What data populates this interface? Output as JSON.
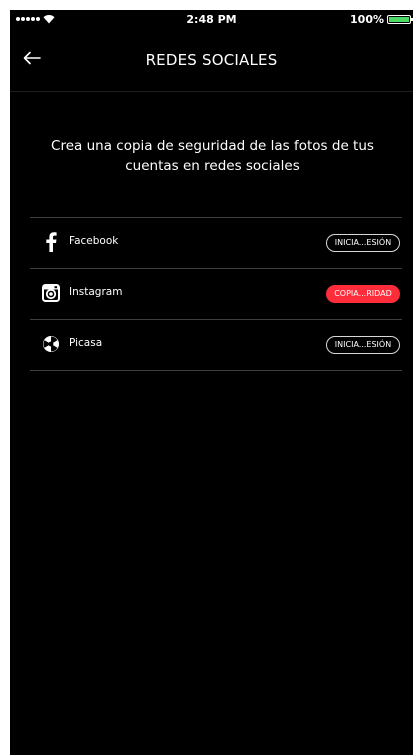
{
  "status_bar": {
    "time": "2:48 PM",
    "battery": "100%",
    "battery_level": 1.0,
    "battery_color": "#4cd964"
  },
  "nav": {
    "title": "REDES SOCIALES",
    "back_icon": "arrow-left-icon"
  },
  "intro_text": "Crea una copia de seguridad de las fotos de tus cuentas en redes sociales",
  "accounts": [
    {
      "icon": "facebook-icon",
      "label": "Facebook",
      "action": "INICIA...ESIÓN",
      "style": "outline"
    },
    {
      "icon": "instagram-icon",
      "label": "Instagram",
      "action": "COPIA...RIDAD",
      "style": "filled"
    },
    {
      "icon": "picasa-icon",
      "label": "Picasa",
      "action": "INICIA...ESIÓN",
      "style": "outline"
    }
  ],
  "colors": {
    "background": "#000000",
    "text": "#ffffff",
    "accent_red": "#ff2d3a",
    "divider": "#3e3e3e"
  }
}
